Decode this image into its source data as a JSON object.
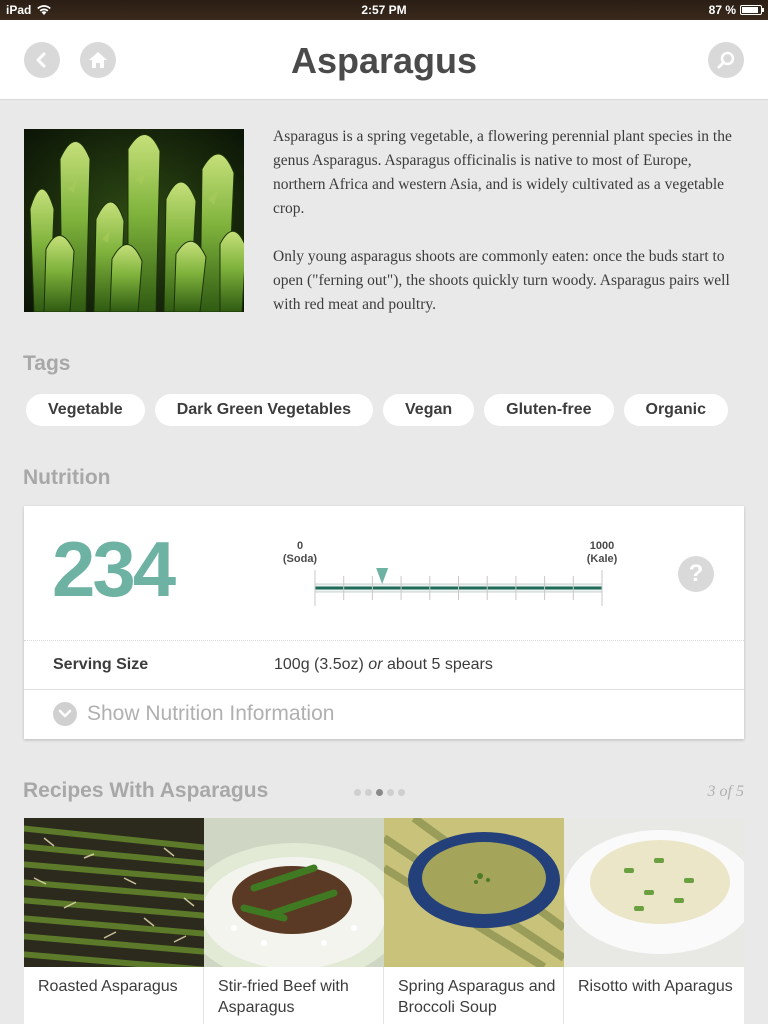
{
  "status": {
    "device": "iPad",
    "time": "2:57 PM",
    "battery": "87 %",
    "battery_level": 0.87
  },
  "header": {
    "title": "Asparagus",
    "icons": {
      "back": "back-arrow-icon",
      "home": "home-icon",
      "search": "search-icon"
    }
  },
  "description": {
    "p1": "Asparagus is a spring vegetable, a flowering perennial plant species in the genus Asparagus. Asparagus officinalis is native to most of Europe, northern Africa and western Asia, and is widely cultivated as a vegetable crop.",
    "p2": "Only young asparagus shoots are commonly eaten: once the buds start to open (\"ferning out\"), the shoots quickly turn woody. Asparagus pairs well with red meat and poultry."
  },
  "tags": {
    "heading": "Tags",
    "items": [
      "Vegetable",
      "Dark Green Vegetables",
      "Vegan",
      "Gluten-free",
      "Organic"
    ]
  },
  "nutrition": {
    "heading": "Nutrition",
    "score": "234",
    "scale_min_value": "0",
    "scale_min_label": "(Soda)",
    "scale_max_value": "1000",
    "scale_max_label": "(Kale)",
    "marker_value": 234,
    "scale_range": [
      0,
      1000
    ],
    "help": "?",
    "serving_label": "Serving Size",
    "serving_amount": "100g (3.5oz)",
    "serving_or": "or",
    "serving_alt": "about 5 spears",
    "show_info": "Show Nutrition Information",
    "accent_color": "#6eb2a4",
    "bar_color": "#1f6b5a"
  },
  "recipes": {
    "heading": "Recipes With Asparagus",
    "pager": "3 of 5",
    "page_count": 5,
    "active_page": 3,
    "items": [
      {
        "name": "Roasted Asparagus"
      },
      {
        "name": "Stir-fried Beef with Asparagus"
      },
      {
        "name": "Spring Asparagus and Broccoli Soup"
      },
      {
        "name": "Risotto with Aparagus"
      }
    ]
  }
}
